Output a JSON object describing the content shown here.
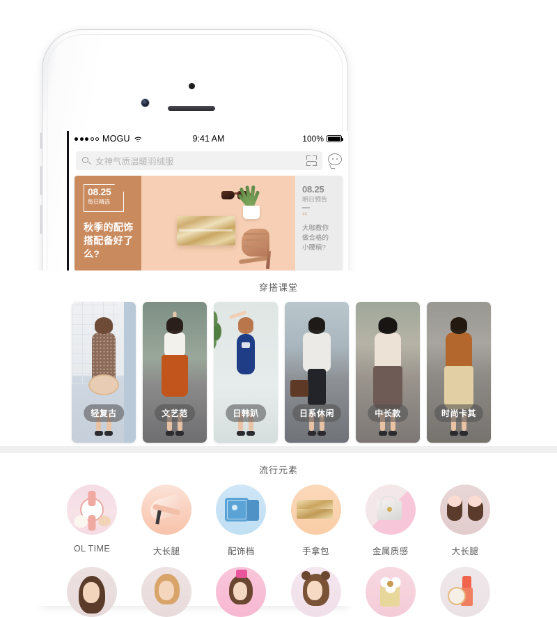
{
  "device": {
    "type": "iphone-mockup",
    "frame_color": "#ffffff"
  },
  "status_bar": {
    "carrier": "MOGU",
    "signal_dots_filled": 3,
    "signal_dots_total": 5,
    "wifi_icon": "wifi-icon",
    "time": "9:41 AM",
    "battery_percent": "100%",
    "battery_icon": "battery-full-icon"
  },
  "search": {
    "search_icon": "search-icon",
    "placeholder": "女神气质温暖羽绒服",
    "scan_icon": "scan-code-icon",
    "chat_icon": "chat-bubble-icon"
  },
  "banner": {
    "badge_date": "08.25",
    "badge_label": "每日精选",
    "title_lines": [
      "秋季的配饰",
      "搭配备好了",
      "么?"
    ],
    "title": "秋季的配饰搭配备好了么?",
    "bg_color": "#c98a5d",
    "preview": {
      "date": "08.25",
      "label": "明日预告",
      "quote_icon": "quote-mark-icon",
      "text_lines": [
        "大咖教你",
        "做合格的",
        "小腰精?"
      ],
      "text": "大咖教你做合格的小腰精?",
      "bg_color": "#ececec"
    }
  },
  "sections": [
    {
      "title": "穿搭课堂",
      "type": "look-cards",
      "items": [
        {
          "label": "轻复古"
        },
        {
          "label": "文艺范"
        },
        {
          "label": "日韩趴"
        },
        {
          "label": "日系休闲"
        },
        {
          "label": "中长款"
        },
        {
          "label": "时尚卡其"
        }
      ]
    },
    {
      "title": "流行元素",
      "type": "circle-grid",
      "row1": [
        {
          "label": "OL TIME"
        },
        {
          "label": "大长腿"
        },
        {
          "label": "配饰档"
        },
        {
          "label": "手拿包"
        },
        {
          "label": "金属质感"
        },
        {
          "label": "大长腿"
        }
      ],
      "row2": [
        {
          "label": ""
        },
        {
          "label": ""
        },
        {
          "label": ""
        },
        {
          "label": ""
        },
        {
          "label": ""
        },
        {
          "label": ""
        }
      ]
    }
  ],
  "colors": {
    "accent_brown": "#c98a5d",
    "divider_gray": "#efefef",
    "text_gray": "#5c5c5c",
    "placeholder_gray": "#b6b6b6"
  }
}
